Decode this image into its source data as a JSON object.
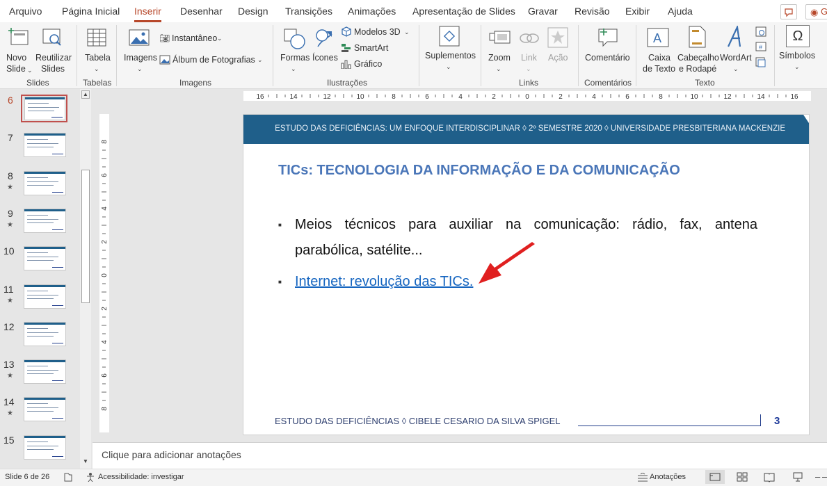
{
  "tabs": [
    "Arquivo",
    "Página Inicial",
    "Inserir",
    "Desenhar",
    "Design",
    "Transições",
    "Animações",
    "Apresentação de Slides",
    "Gravar",
    "Revisão",
    "Exibir",
    "Ajuda"
  ],
  "active_tab": "Inserir",
  "corner_right": "G",
  "ribbon": {
    "novo_slide": [
      "Novo",
      "Slide"
    ],
    "reutilizar": [
      "Reutilizar",
      "Slides"
    ],
    "tabela": "Tabela",
    "imagens": "Imagens",
    "instantaneo": "Instantâneo",
    "album": "Álbum de Fotografias",
    "formas": "Formas",
    "icones": "Ícones",
    "modelos3d": "Modelos 3D",
    "smartart": "SmartArt",
    "grafico": "Gráfico",
    "suplementos": "Suplementos",
    "zoom": "Zoom",
    "link": "Link",
    "acao": "Ação",
    "comentario": "Comentário",
    "caixa": [
      "Caixa",
      "de Texto"
    ],
    "cabecalho": [
      "Cabeçalho",
      "e Rodapé"
    ],
    "wordart": "WordArt",
    "simbolos": "Símbolos",
    "groups": {
      "slides": "Slides",
      "tabelas": "Tabelas",
      "imagens": "Imagens",
      "ilustracoes": "Ilustrações",
      "links": "Links",
      "comentarios": "Comentários",
      "texto": "Texto"
    }
  },
  "slides_panel": [
    {
      "n": "6",
      "star": false,
      "current": true
    },
    {
      "n": "7",
      "star": false
    },
    {
      "n": "8",
      "star": true
    },
    {
      "n": "9",
      "star": true
    },
    {
      "n": "10",
      "star": false
    },
    {
      "n": "11",
      "star": true
    },
    {
      "n": "12",
      "star": false
    },
    {
      "n": "13",
      "star": true
    },
    {
      "n": "14",
      "star": true
    },
    {
      "n": "15",
      "star": false
    }
  ],
  "ruler_h": [
    "16",
    "14",
    "12",
    "10",
    "8",
    "6",
    "4",
    "2",
    "0",
    "2",
    "4",
    "6",
    "8",
    "10",
    "12",
    "14",
    "16"
  ],
  "ruler_v": [
    "8",
    "6",
    "4",
    "2",
    "0",
    "2",
    "4",
    "6",
    "8"
  ],
  "slide": {
    "header": "ESTUDO DAS DEFICIÊNCIAS: UM ENFOQUE INTERDISCIPLINAR ◊  2º SEMESTRE 2020  ◊  UNIVERSIDADE PRESBITERIANA MACKENZIE",
    "title": "TICs: TECNOLOGIA DA INFORMAÇÃO E DA COMUNICAÇÃO",
    "bullet1_line1": "Meios técnicos para auxiliar na comunicação: rádio, fax, antena",
    "bullet1_line2": "parabólica, satélite...",
    "bullet2_link": "Internet: revolução das TICs.",
    "footer": "ESTUDO DAS DEFICIÊNCIAS ◊  CIBELE CESARIO DA SILVA SPIGEL",
    "page_number": "3"
  },
  "notes_placeholder": "Clique para adicionar anotações",
  "status": {
    "slide_count": "Slide 6 de 26",
    "accessibility": "Acessibilidade: investigar",
    "notes": "Anotações"
  },
  "colors": {
    "accent": "#b7472a",
    "slide_header": "#1f5f8a",
    "title": "#4a76b8",
    "link": "#1565c0",
    "arrow": "#e02020"
  }
}
